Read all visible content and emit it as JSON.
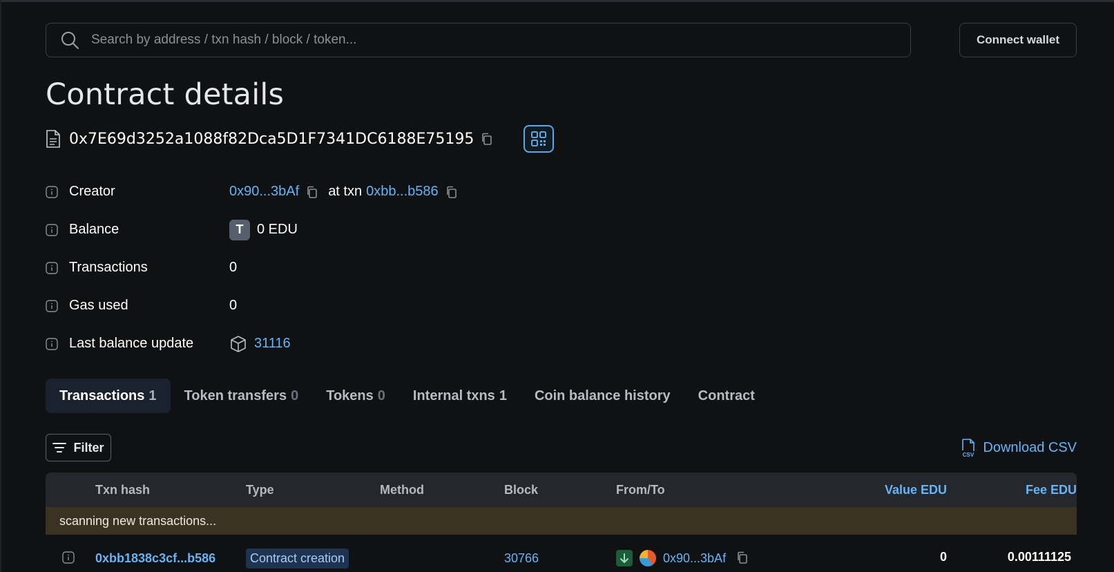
{
  "header": {
    "search_placeholder": "Search by address / txn hash / block / token...",
    "connect_label": "Connect wallet"
  },
  "page": {
    "title": "Contract details",
    "address": "0x7E69d3252a1088f82Dca5D1F7341DC6188E75195"
  },
  "details": {
    "creator": {
      "label": "Creator",
      "address": "0x90...3bAf",
      "at_txn": "at txn",
      "txn": "0xbb...b586"
    },
    "balance": {
      "label": "Balance",
      "token_letter": "T",
      "value": "0 EDU"
    },
    "transactions": {
      "label": "Transactions",
      "value": "0"
    },
    "gas_used": {
      "label": "Gas used",
      "value": "0"
    },
    "last_balance_update": {
      "label": "Last balance update",
      "block": "31116"
    }
  },
  "tabs": [
    {
      "label": "Transactions",
      "count": "1"
    },
    {
      "label": "Token transfers",
      "count": "0"
    },
    {
      "label": "Tokens",
      "count": "0"
    },
    {
      "label": "Internal txns",
      "count": "1"
    },
    {
      "label": "Coin balance history",
      "count": ""
    },
    {
      "label": "Contract",
      "count": ""
    }
  ],
  "toolbar": {
    "filter_label": "Filter",
    "csv_label": "Download CSV"
  },
  "table": {
    "columns": {
      "hash": "Txn hash",
      "type": "Type",
      "method": "Method",
      "block": "Block",
      "fromto": "From/To",
      "value": "Value EDU",
      "fee": "Fee EDU"
    },
    "scanning": "scanning new transactions...",
    "rows": [
      {
        "hash": "0xbb1838c3cf...b586",
        "type": "Contract creation",
        "block": "30766",
        "from": "0x90...3bAf",
        "value": "0",
        "fee": "0.00111125"
      }
    ]
  },
  "colors": {
    "background": "#101112",
    "link": "#66b3f5",
    "active_tab": "#1a2230",
    "scanning_bg": "#3a3324"
  }
}
